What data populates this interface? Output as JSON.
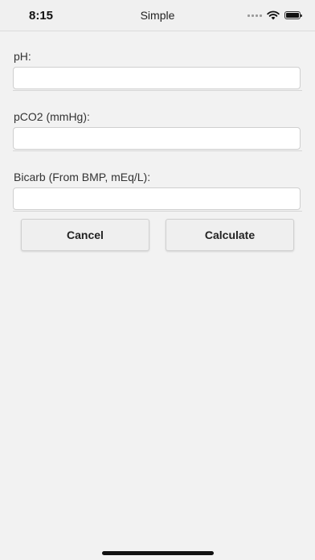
{
  "status_bar": {
    "time": "8:15",
    "title": "Simple",
    "icons": [
      "signal-icon",
      "wifi-icon",
      "battery-icon"
    ]
  },
  "form": {
    "fields": [
      {
        "label": "pH:",
        "value": "",
        "placeholder": ""
      },
      {
        "label": "pCO2 (mmHg):",
        "value": "",
        "placeholder": ""
      },
      {
        "label": "Bicarb (From BMP, mEq/L):",
        "value": "",
        "placeholder": ""
      }
    ]
  },
  "buttons": {
    "cancel_label": "Cancel",
    "calculate_label": "Calculate"
  },
  "colors": {
    "background": "#f2f2f2",
    "status_bar": "#f0f0f0",
    "button_bg": "#efefef"
  }
}
